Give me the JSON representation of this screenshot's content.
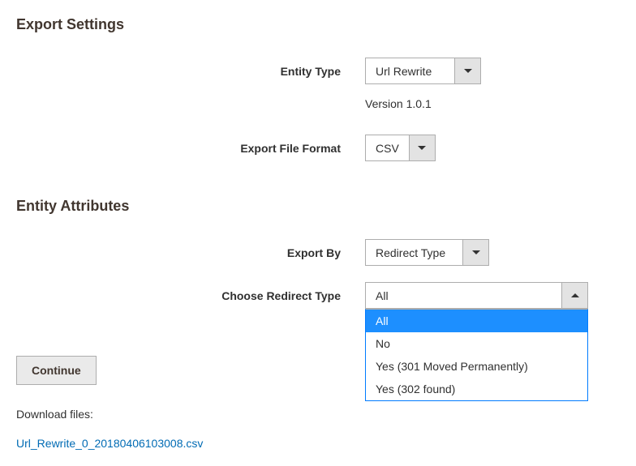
{
  "export_settings": {
    "title": "Export Settings",
    "entity_type": {
      "label": "Entity Type",
      "value": "Url Rewrite"
    },
    "version": "Version 1.0.1",
    "file_format": {
      "label": "Export File Format",
      "value": "CSV"
    }
  },
  "entity_attributes": {
    "title": "Entity Attributes",
    "export_by": {
      "label": "Export By",
      "value": "Redirect Type"
    },
    "redirect_type": {
      "label": "Choose Redirect Type",
      "value": "All",
      "options": [
        "All",
        "No",
        "Yes (301 Moved Permanently)",
        "Yes (302 found)"
      ]
    }
  },
  "actions": {
    "continue": "Continue",
    "download_label": "Download files:",
    "download_file": "Url_Rewrite_0_20180406103008.csv"
  }
}
